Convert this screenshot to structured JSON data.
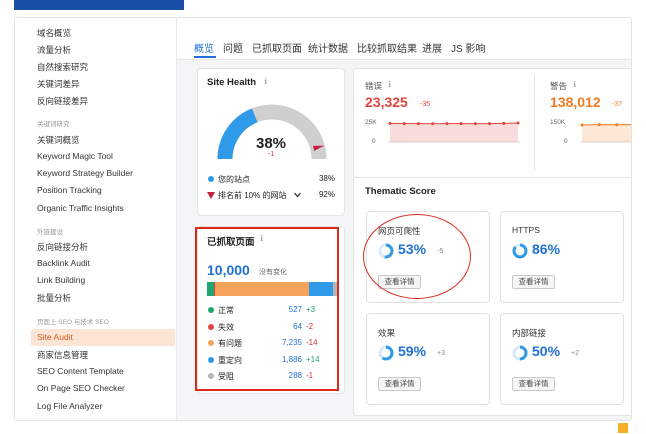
{
  "sidebar": {
    "items": [
      "域名概览",
      "流量分析",
      "自然搜索研究",
      "关键词差异",
      "反向链接差异"
    ],
    "kw_head": "关键词研究",
    "kw_items": [
      "关键词概览",
      "Keyword Magic Tool",
      "Keyword Strategy Builder",
      "Position Tracking",
      "Organic Traffic Insights"
    ],
    "link_head": "外链建设",
    "link_items": [
      "反向链接分析",
      "Backlink Audit",
      "Link Building",
      "批量分析"
    ],
    "seo_head": "页面上 SEO 与技术 SEO",
    "seo_items": [
      "Site Audit",
      "商家信息管理",
      "SEO Content Template",
      "On Page SEO Checker",
      "Log File Analyzer"
    ]
  },
  "tabs": [
    "概览",
    "问题",
    "已抓取页面",
    "统计数据",
    "比较抓取结果",
    "进展",
    "JS 影响"
  ],
  "site_health": {
    "title": "Site Health",
    "info_icon": "ℹ",
    "value": "38%",
    "delta": "-1",
    "rows": [
      {
        "label": "您的站点",
        "value": "38%"
      },
      {
        "label": "排名前 10% 的网站",
        "value": "92%"
      }
    ],
    "gauge_fraction": 0.38,
    "top10_fraction": 0.92,
    "colors": {
      "blue": "#2f9be8",
      "gray": "#c7c7c7",
      "red": "#c4203a"
    }
  },
  "errors": {
    "label": "错误",
    "info_icon": "ℹ",
    "value": "23,325",
    "delta": "-35",
    "y_top": "25K",
    "y_bottom": "0",
    "color": "#e0443c"
  },
  "warnings": {
    "label": "警告",
    "info_icon": "ℹ",
    "value": "138,012",
    "delta": "-37",
    "y_top": "150K",
    "y_bottom": "0",
    "color": "#f27a1f"
  },
  "crawled": {
    "title": "已抓取页面",
    "info_icon": "ℹ",
    "total": "10,000",
    "total_note": "没有变化",
    "rows": [
      {
        "label": "正常",
        "value": "527",
        "delta": "+3",
        "color": "#23a56f"
      },
      {
        "label": "失效",
        "value": "64",
        "delta": "-2",
        "color": "#e0443c"
      },
      {
        "label": "有问题",
        "value": "7,235",
        "delta": "-14",
        "color": "#f5a35b"
      },
      {
        "label": "重定向",
        "value": "1,886",
        "delta": "+14",
        "color": "#2f9be8"
      },
      {
        "label": "受阻",
        "value": "288",
        "delta": "-1",
        "color": "#b5b5b5"
      }
    ]
  },
  "thematic": {
    "title": "Thematic Score",
    "cards": [
      {
        "label": "网页可爬性",
        "value": "53%",
        "delta": "-5",
        "button": "查看详情",
        "fraction": 0.53
      },
      {
        "label": "HTTPS",
        "value": "86%",
        "delta": "",
        "button": "查看详情",
        "fraction": 0.86
      },
      {
        "label": "效果",
        "value": "59%",
        "delta": "+3",
        "button": "查看详情",
        "fraction": 0.59
      },
      {
        "label": "内部链接",
        "value": "50%",
        "delta": "+2",
        "button": "查看详情",
        "fraction": 0.5
      }
    ]
  },
  "accent": "#1f6fd6",
  "annotation_color": "#d92a1c",
  "corner_color": "#f5b028"
}
